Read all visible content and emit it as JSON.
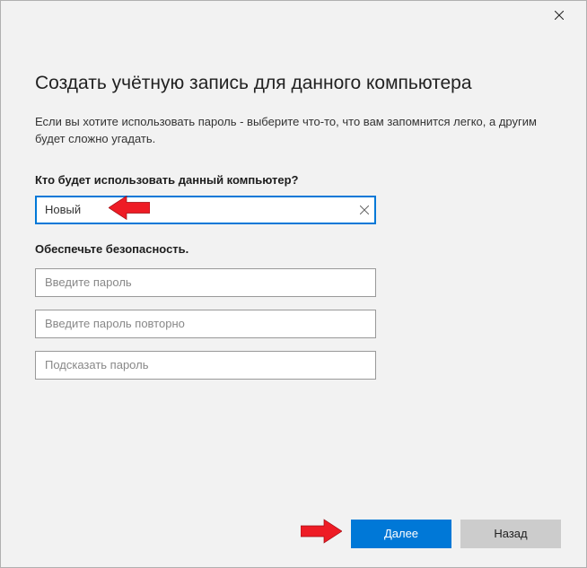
{
  "title": "Создать учётную запись для данного компьютера",
  "description": "Если вы хотите использовать пароль - выберите что-то, что вам запомнится легко, а другим будет сложно угадать.",
  "username_section_label": "Кто будет использовать данный компьютер?",
  "username_value": "Новый",
  "security_section_label": "Обеспечьте безопасность.",
  "password_placeholder": "Введите пароль",
  "password_confirm_placeholder": "Введите пароль повторно",
  "password_hint_placeholder": "Подсказать пароль",
  "next_button": "Далее",
  "back_button": "Назад",
  "colors": {
    "accent": "#0078d7",
    "arrow": "#ee1c25"
  }
}
